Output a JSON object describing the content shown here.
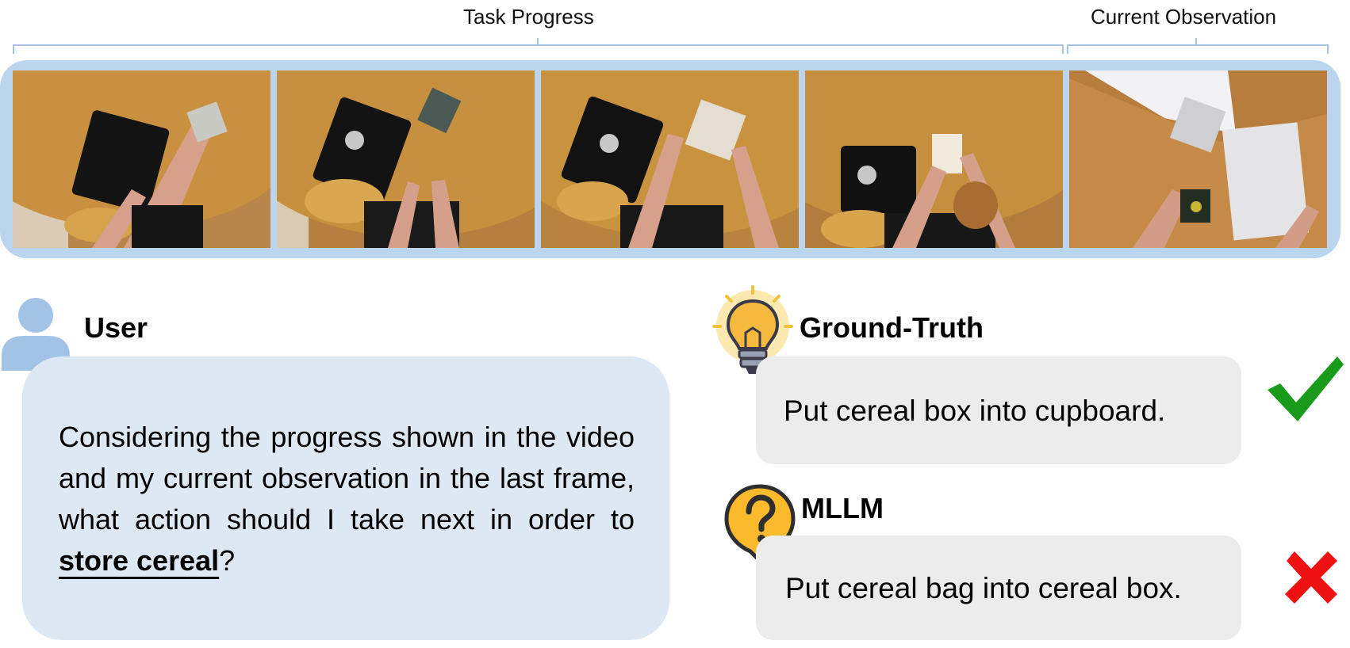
{
  "labels": {
    "task_progress": "Task Progress",
    "current_observation": "Current Observation"
  },
  "frames": [
    {
      "name": "progress-frame-1",
      "scene": "hands placing a box beside a black tray with a cup on a wooden table"
    },
    {
      "name": "progress-frame-2",
      "scene": "black tray with cup on wooden table, box nearby"
    },
    {
      "name": "progress-frame-3",
      "scene": "hands opening a cereal bag above the table"
    },
    {
      "name": "progress-frame-4",
      "scene": "hands holding a cereal box next to the tray"
    },
    {
      "name": "current-observation-frame",
      "scene": "hand holding a box beside an open cupboard"
    }
  ],
  "user": {
    "speaker": "User",
    "question_prefix": "Considering the progress shown in the video and my current observation in the last frame, what action should I take next in order to",
    "question_keyword": "store cereal",
    "question_suffix": "?"
  },
  "ground_truth": {
    "speaker": "Ground-Truth",
    "answer": "Put cereal box into cupboard.",
    "verdict_icon": "check-mark-icon",
    "verdict_color": "#1a9a1a"
  },
  "mllm": {
    "speaker": "MLLM",
    "answer": "Put cereal bag into cereal box.",
    "verdict_icon": "cross-mark-icon",
    "verdict_color": "#ee1111"
  },
  "colors": {
    "strip": "#bcd5ee",
    "user_bubble": "#dde8f5",
    "answer_bubble": "#ececec",
    "bracket": "#a9c4e0"
  }
}
